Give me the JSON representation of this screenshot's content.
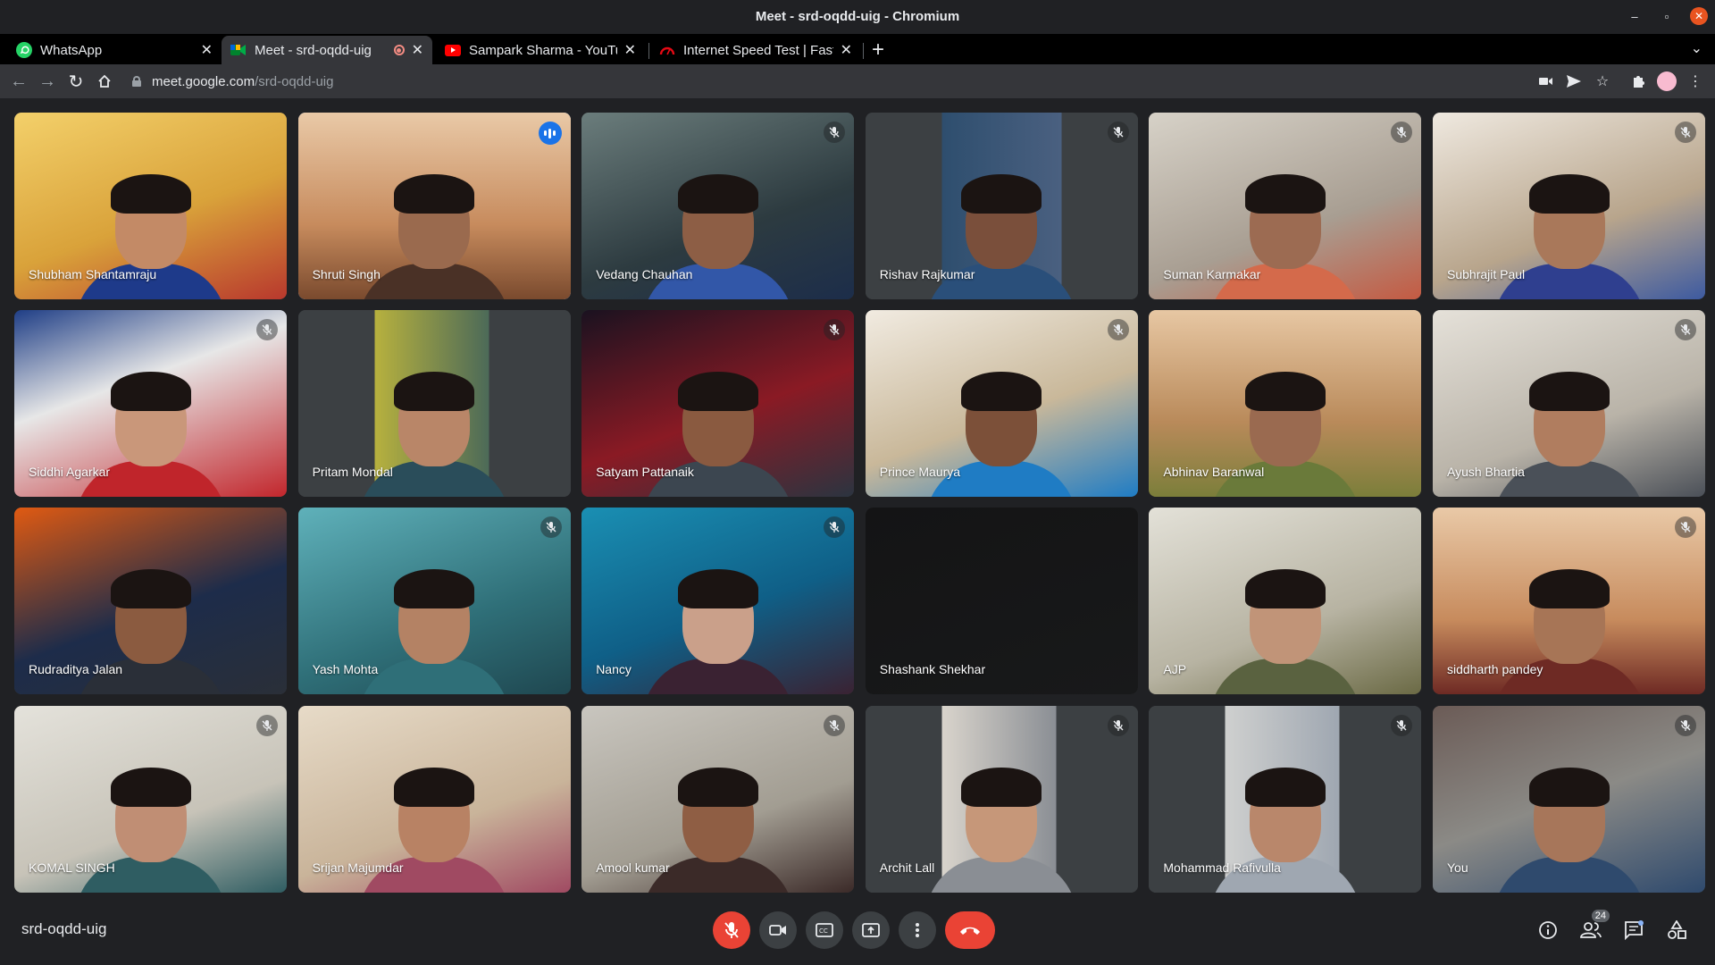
{
  "window": {
    "title": "Meet - srd-oqdd-uig - Chromium"
  },
  "tabs": [
    {
      "label": "WhatsApp",
      "favicon": "whatsapp-icon",
      "color": "#25d366"
    },
    {
      "label": "Meet - srd-oqdd-uig",
      "favicon": "meet-icon",
      "color": "#00832d",
      "recording": true
    },
    {
      "label": "Sampark Sharma - YouTube",
      "favicon": "youtube-icon",
      "color": "#ff0000"
    },
    {
      "label": "Internet Speed Test | Fast.com",
      "favicon": "speedtest-icon",
      "color": "#e50914"
    }
  ],
  "address": {
    "host": "meet.google.com",
    "path": "/srd-oqdd-uig"
  },
  "participants": [
    {
      "name": "Shubham Shantamraju",
      "muted": false
    },
    {
      "name": "Shruti Singh",
      "muted": false,
      "speaking": true
    },
    {
      "name": "Vedang Chauhan",
      "muted": true
    },
    {
      "name": "Rishav Rajkumar",
      "muted": true
    },
    {
      "name": "Suman Karmakar",
      "muted": true
    },
    {
      "name": "Subhrajit Paul",
      "muted": true
    },
    {
      "name": "Siddhi Agarkar",
      "muted": true
    },
    {
      "name": "Pritam Mondal",
      "muted": false
    },
    {
      "name": "Satyam Pattanaik",
      "muted": true
    },
    {
      "name": "Prince Maurya",
      "muted": true
    },
    {
      "name": "Abhinav Baranwal",
      "muted": false
    },
    {
      "name": "Ayush Bhartia",
      "muted": true
    },
    {
      "name": "Rudraditya Jalan",
      "muted": false
    },
    {
      "name": "Yash Mohta",
      "muted": true
    },
    {
      "name": "Nancy",
      "muted": true
    },
    {
      "name": "Shashank Shekhar",
      "muted": false
    },
    {
      "name": "AJP",
      "muted": false
    },
    {
      "name": "siddharth pandey",
      "muted": true
    },
    {
      "name": "KOMAL SINGH",
      "muted": true
    },
    {
      "name": "Srijan Majumdar",
      "muted": false
    },
    {
      "name": "Amool kumar",
      "muted": true
    },
    {
      "name": "Archit Lall",
      "muted": true
    },
    {
      "name": "Mohammad Rafivulla",
      "muted": true
    },
    {
      "name": "You",
      "muted": true
    }
  ],
  "meeting": {
    "code": "srd-oqdd-uig",
    "participant_count": "24"
  },
  "colors": {
    "accent": "#8ab4f8",
    "danger": "#ea4335",
    "bar": "#202124",
    "tile": "#3c4043"
  }
}
